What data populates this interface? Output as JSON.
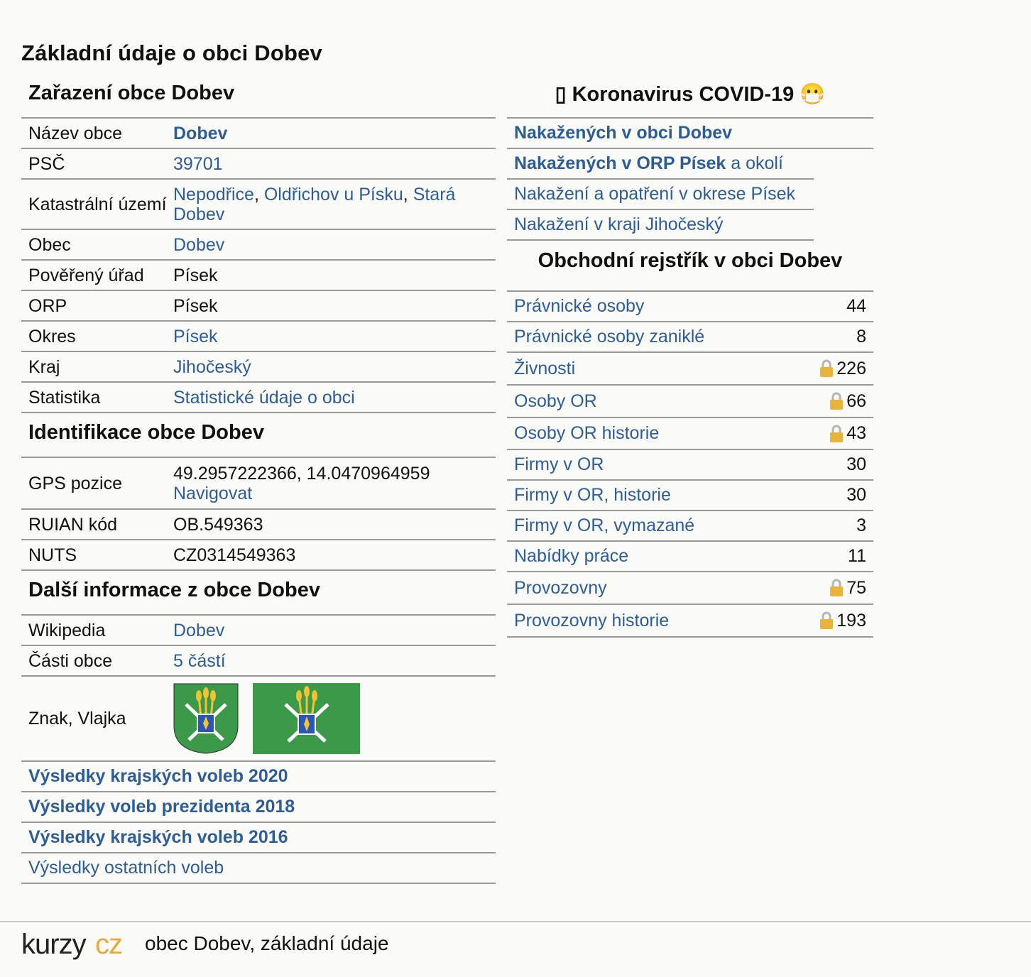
{
  "page_title": "Základní údaje o obci Dobev",
  "zarazeni": {
    "title": "Zařazení obce Dobev",
    "nazev_label": "Název obce",
    "nazev_value": "Dobev",
    "psc_label": "PSČ",
    "psc_value": "39701",
    "katastr_label": "Katastrální území",
    "katastr_1": "Nepodřice",
    "katastr_2": "Oldřichov u Písku",
    "katastr_3": "Stará Dobev",
    "obec_label": "Obec",
    "obec_value": "Dobev",
    "poverny_label": "Pověřený úřad",
    "poverny_value": "Písek",
    "orp_label": "ORP",
    "orp_value": "Písek",
    "okres_label": "Okres",
    "okres_value": "Písek",
    "kraj_label": "Kraj",
    "kraj_value": "Jihočeský",
    "stat_label": "Statistika",
    "stat_value": "Statistické údaje o obci"
  },
  "identifikace": {
    "title": "Identifikace obce Dobev",
    "gps_label": "GPS pozice",
    "gps_value": "49.2957222366, 14.0470964959",
    "gps_link": "Navigovat",
    "ruian_label": "RUIAN kód",
    "ruian_value": "OB.549363",
    "nuts_label": "NUTS",
    "nuts_value": "CZ0314549363"
  },
  "dalsi": {
    "title": "Další informace z obce Dobev",
    "wiki_label": "Wikipedia",
    "wiki_value": "Dobev",
    "casti_label": "Části obce",
    "casti_value": "5 částí",
    "znak_label": "Znak, Vlajka"
  },
  "volby": {
    "kraj2020": "Výsledky krajských voleb 2020",
    "prez2018": "Výsledky voleb prezidenta 2018",
    "kraj2016": "Výsledky krajských voleb 2016",
    "ostatni": "Výsledky ostatních voleb"
  },
  "covid": {
    "title_box": "▯",
    "title": "Koronavirus COVID-19",
    "title_face": "😷",
    "obec_link": "Nakažených v obci Dobev",
    "orp_link_bold": "Nakažených v ORP Písek",
    "orp_link_rest": " a okolí",
    "okres_link": "Nakažení a opatření v okrese Písek",
    "kraj_link": "Nakažení v kraji Jihočeský"
  },
  "rejstrik": {
    "title": "Obchodní rejstřík v obci Dobev",
    "items": [
      {
        "label": "Právnické osoby",
        "value": "44"
      },
      {
        "label": "Právnické osoby zaniklé",
        "value": "8"
      },
      {
        "label": "Živnosti",
        "value": "226"
      },
      {
        "label": "Osoby OR",
        "value": "66"
      },
      {
        "label": "Osoby OR historie",
        "value": "43"
      },
      {
        "label": "Firmy v OR",
        "value": "30"
      },
      {
        "label": "Firmy v OR, historie",
        "value": "30"
      },
      {
        "label": "Firmy v OR, vymazané",
        "value": "3"
      },
      {
        "label": "Nabídky práce",
        "value": "11"
      },
      {
        "label": "Provozovny",
        "value": "75"
      },
      {
        "label": "Provozovny historie",
        "value": "193"
      }
    ]
  },
  "footer": {
    "logo_a": "kurzy",
    "logo_b": "cz",
    "text": "obec Dobev, základní údaje"
  },
  "colors": {
    "link": "#2d5d94",
    "flag_green": "#3a9a4a",
    "logo_orange": "#e8a93c"
  }
}
